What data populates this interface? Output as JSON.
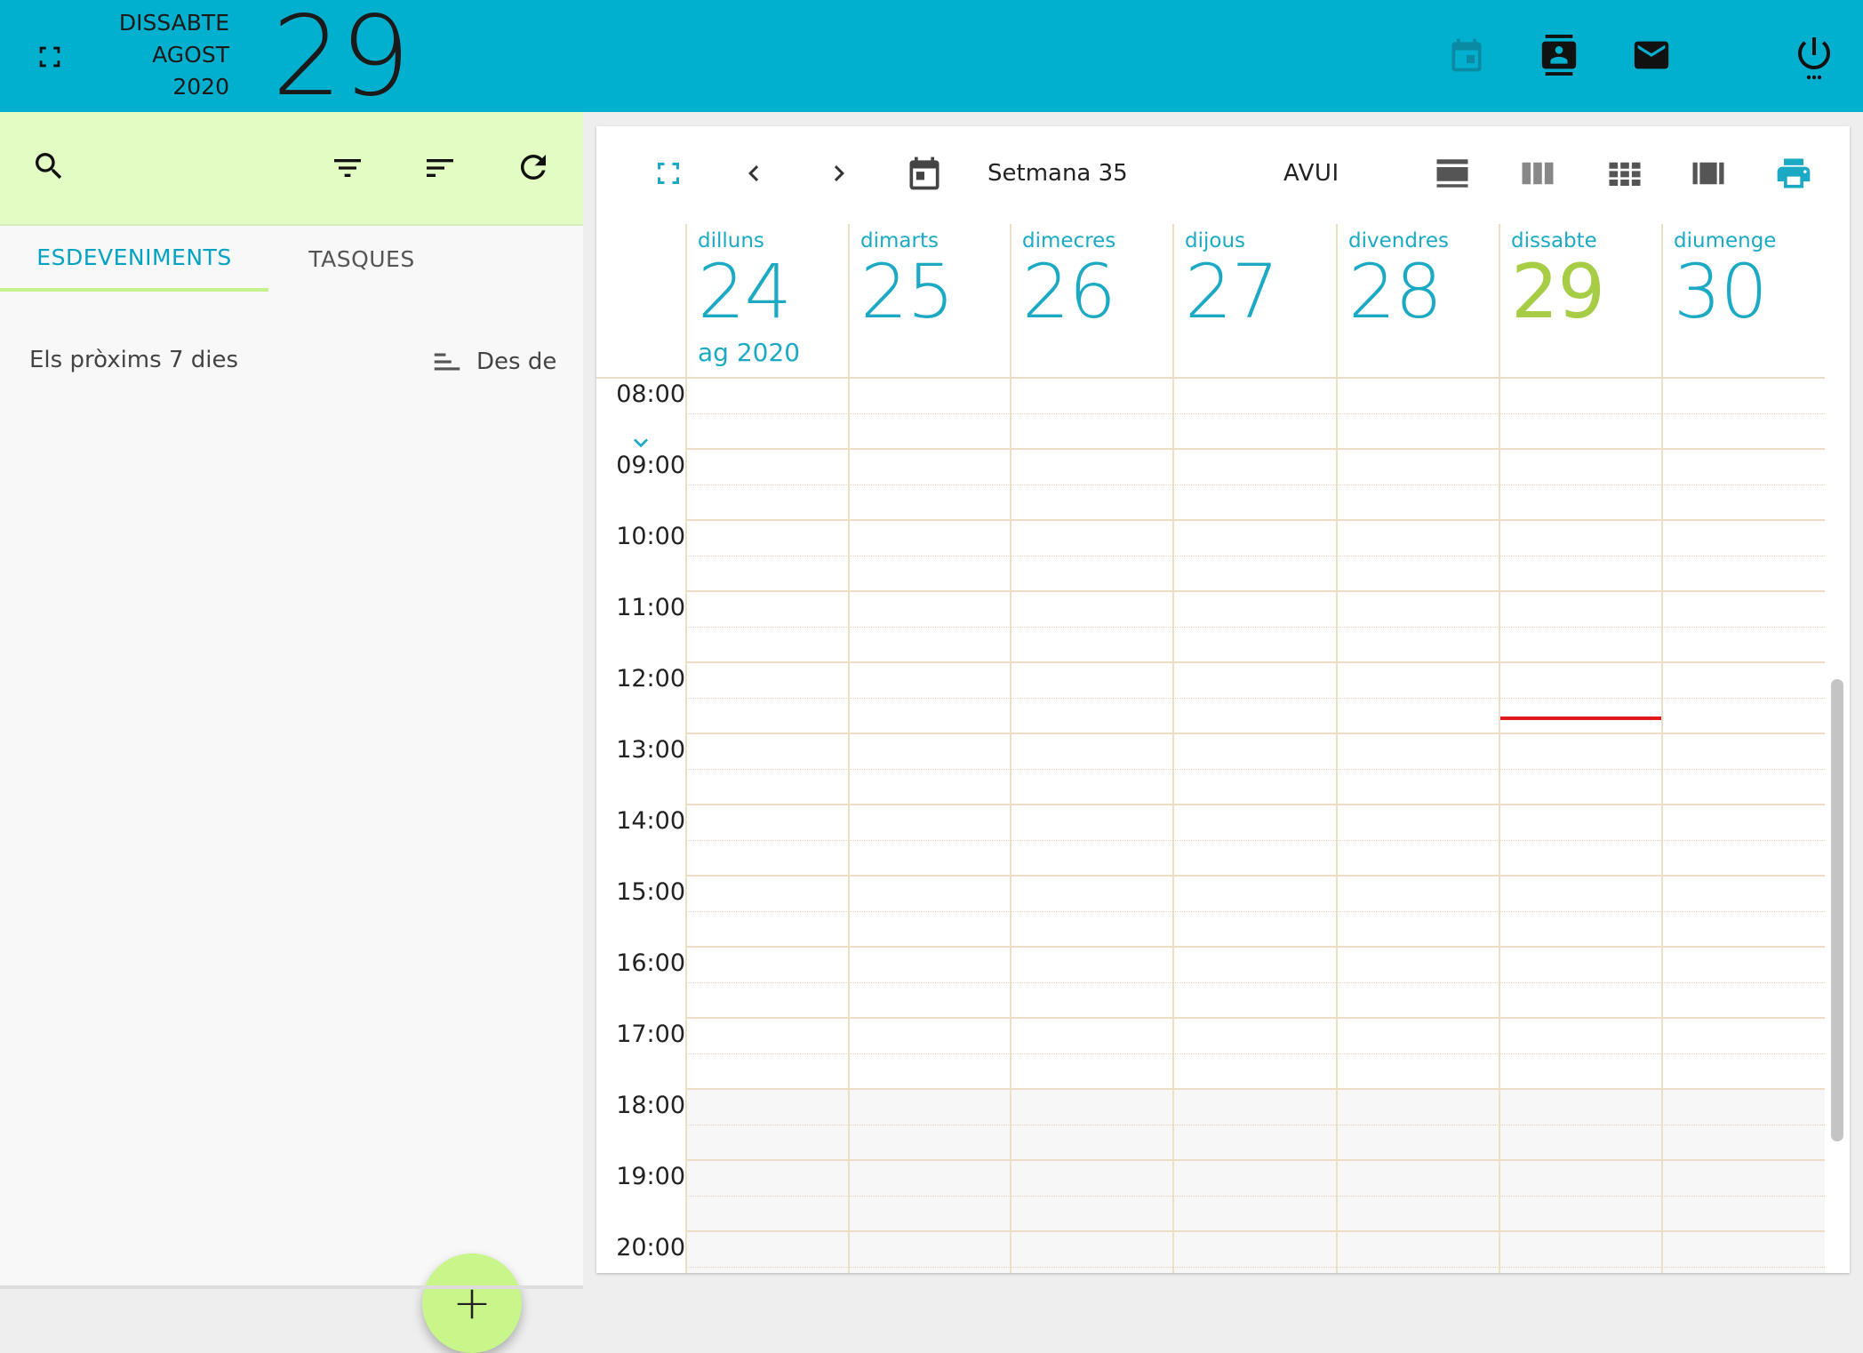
{
  "header": {
    "weekday": "DISSABTE",
    "month": "AGOST",
    "year": "2020",
    "day": "29",
    "background": "#01b0cf"
  },
  "apps": [
    "calendar-icon",
    "contacts-icon",
    "mail-icon"
  ],
  "left_panel": {
    "tabs": [
      {
        "label": "ESDEVENIMENTS",
        "active": true
      },
      {
        "label": "TASQUES",
        "active": false
      }
    ],
    "range_label": "Els pròxims 7 dies",
    "sort_label": "Des de",
    "add_button_symbol": "+"
  },
  "calendar": {
    "week_label": "Setmana 35",
    "today_label": "AVUI",
    "days": [
      {
        "name": "dilluns",
        "number": "24"
      },
      {
        "name": "dimarts",
        "number": "25"
      },
      {
        "name": "dimecres",
        "number": "26"
      },
      {
        "name": "dijous",
        "number": "27"
      },
      {
        "name": "divendres",
        "number": "28"
      },
      {
        "name": "dissabte",
        "number": "29",
        "today": true
      },
      {
        "name": "diumenge",
        "number": "30"
      }
    ],
    "month_year": "ag 2020",
    "hours": [
      "08:00",
      "09:00",
      "10:00",
      "11:00",
      "12:00",
      "13:00",
      "14:00",
      "15:00",
      "16:00",
      "17:00",
      "18:00",
      "19:00",
      "20:00"
    ],
    "accent_color": "#1ba9c4",
    "today_color": "#a7cc46",
    "now_line_color": "#e01a1a"
  }
}
